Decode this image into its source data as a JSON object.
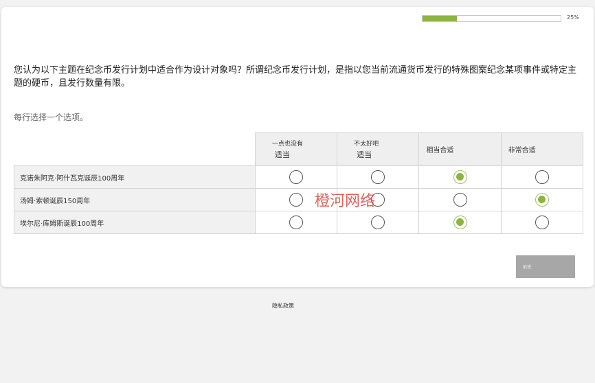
{
  "progress": {
    "percent_label": "25%",
    "value": 0.25,
    "fill_color": "#8cb540"
  },
  "question": {
    "text": "您认为以下主题在纪念币发行计划中适合作为设计对象吗？所谓纪念币发行计划，是指以您当前流通货币发行的特殊图案纪念某项事件或特定主题的硬币，且发行数量有限。",
    "instruction": "每行选择一个选项。"
  },
  "columns": [
    {
      "line1": "一点也没有",
      "line2": "适当"
    },
    {
      "line1": "不太好吧",
      "line2": "适当"
    },
    {
      "label": "相当合适"
    },
    {
      "label": "非常合适"
    }
  ],
  "rows": [
    {
      "label": "克诺朱阿克·阿什瓦克诞辰100周年",
      "selected": 2
    },
    {
      "label": "汤姆·索顿诞辰150周年",
      "selected": 3
    },
    {
      "label": "埃尔尼·库姆斯诞辰100周年",
      "selected": 2
    }
  ],
  "buttons": {
    "next_label": "前进"
  },
  "footer": {
    "privacy_label": "隐私政策"
  },
  "watermark": "橙河网络",
  "colors": {
    "accent": "#8cb540",
    "button": "#a7a7a7"
  }
}
